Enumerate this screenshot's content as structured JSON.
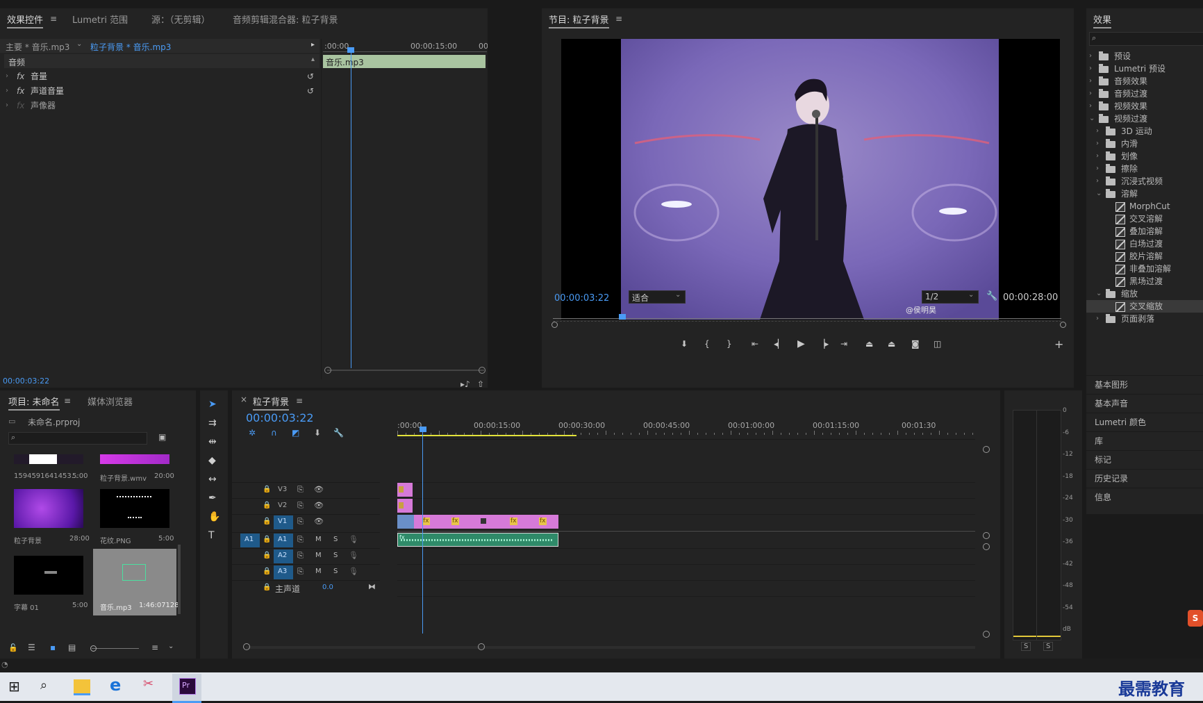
{
  "effect_controls": {
    "tabs": [
      "效果控件",
      "Lumetri 范围",
      "源：（无剪辑）",
      "音频剪辑混合器: 粒子背景"
    ],
    "menu_glyph": "≡",
    "master_clip": "主要 * 音乐.mp3",
    "sequence_clip": "粒子背景 * 音乐.mp3",
    "time_start": ":00:00",
    "time_mid": "00:00:15:00",
    "time_end": "00",
    "clip_label": "音乐.mp3",
    "section": "音频",
    "effects": [
      "音量",
      "声道音量",
      "声像器"
    ],
    "timecode": "00:00:03:22"
  },
  "program": {
    "title": "节目: 粒子背景",
    "menu_glyph": "≡",
    "timecode": "00:00:03:22",
    "fit": "适合",
    "resolution": "1/2",
    "duration": "00:00:28:00",
    "watermark": "@侯明昊",
    "add_glyph": "+"
  },
  "effects_panel": {
    "title": "效果",
    "top_items": [
      "预设",
      "Lumetri 预设",
      "音频效果",
      "音频过渡",
      "视频效果",
      "视频过渡"
    ],
    "video_transition_children": [
      "3D 运动",
      "内滑",
      "划像",
      "擦除",
      "沉浸式视频",
      "溶解"
    ],
    "dissolve_children": [
      "MorphCut",
      "交叉溶解",
      "叠加溶解",
      "白场过渡",
      "胶片溶解",
      "非叠加溶解",
      "黑场过渡"
    ],
    "zoom_folder": "缩放",
    "zoom_children": [
      "交叉缩放"
    ],
    "page_peel": "页面剥落",
    "sidebar": [
      "基本图形",
      "基本声音",
      "Lumetri 颜色",
      "库",
      "标记",
      "历史记录",
      "信息"
    ]
  },
  "project": {
    "tabs": [
      "项目: 未命名",
      "媒体浏览器"
    ],
    "menu_glyph": "≡",
    "file": "未命名.prproj",
    "items": [
      {
        "name": "1594591641453...",
        "duration": "5:00"
      },
      {
        "name": "粒子背景.wmv",
        "duration": "20:00"
      },
      {
        "name": "粒子背景",
        "duration": "28:00"
      },
      {
        "name": "花纹.PNG",
        "duration": "5:00"
      },
      {
        "name": "字幕 01",
        "duration": "5:00"
      },
      {
        "name": "音乐.mp3",
        "duration": "1:46:07128"
      }
    ]
  },
  "timeline": {
    "close_glyph": "×",
    "title": "粒子背景",
    "menu_glyph": "≡",
    "timecode": "00:00:03:22",
    "ruler": [
      ":00:00",
      "00:00:15:00",
      "00:00:30:00",
      "00:00:45:00",
      "00:01:00:00",
      "00:01:15:00",
      "00:01:30"
    ],
    "video_tracks": [
      "V3",
      "V2",
      "V1"
    ],
    "audio_tracks": [
      "A1",
      "A2",
      "A3"
    ],
    "source_patch": "A1",
    "m": "M",
    "s": "S",
    "master": "主声道",
    "master_value": "0.0",
    "fx": "fx"
  },
  "meter": {
    "scale": [
      "0",
      "-6",
      "-12",
      "-18",
      "-24",
      "-30",
      "-36",
      "-42",
      "-48",
      "-54",
      "dB"
    ],
    "solo": [
      "S",
      "S"
    ]
  },
  "tools": [
    "selection-tool",
    "track-select-tool",
    "ripple-edit-tool",
    "razor-tool",
    "slip-tool",
    "pen-tool",
    "hand-tool",
    "type-tool"
  ],
  "taskbar": {
    "app": "Pr",
    "watermark": "最需教育"
  },
  "colors": {
    "accent": "#4a9bf5",
    "clip_video": "#d67ad8",
    "clip_audio": "#2f8a69",
    "audio_bar": "#a9c4a0"
  }
}
